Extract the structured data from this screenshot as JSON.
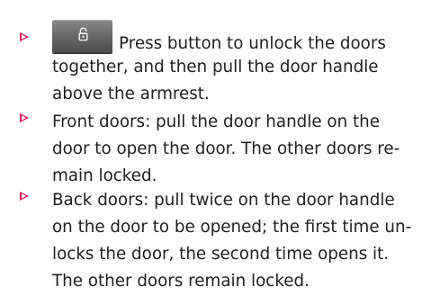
{
  "instructions": [
    {
      "icon": "unlock-icon",
      "lines": [
        "Press button to unlock the doors",
        "together, and then pull the door handle",
        "above the armrest."
      ]
    },
    {
      "lines": [
        "Front doors: pull the door handle on the",
        "door to open the door. The other doors re-",
        "main locked."
      ]
    },
    {
      "lines": [
        "Back doors: pull twice on the door handle",
        "on the door to be opened; the first time un-",
        "locks the door, the second time opens it.",
        "The other doors remain locked."
      ]
    }
  ],
  "colors": {
    "bullet": "#d7004b",
    "text": "#1e1e1e",
    "button": "#6a6a6a"
  }
}
